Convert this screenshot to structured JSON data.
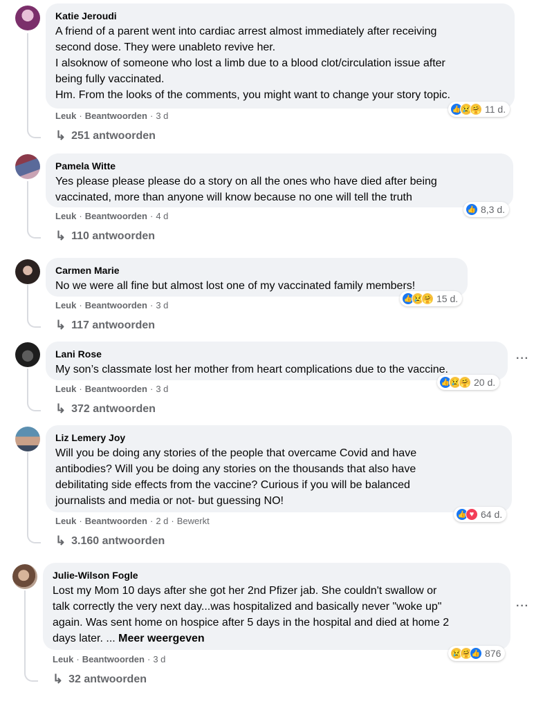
{
  "comments": [
    {
      "author": "Katie Jeroudi",
      "lines": [
        "A friend of a parent went into cardiac arrest almost immediately after receiving",
        "second dose. They were unableto revive her.",
        "I alsoknow of someone who lost a limb due to a blood clot/circulation issue after",
        "being fully vaccinated.",
        "Hm. From the looks of the comments, you might want to change your story topic."
      ],
      "reactions": [
        "like",
        "sad",
        "care"
      ],
      "reaction_count": "11 d.",
      "like": "Leuk",
      "reply": "Beantwoorden",
      "time": "3 d",
      "edited": "",
      "replies": "251 antwoorden"
    },
    {
      "author": "Pamela Witte",
      "lines": [
        "Yes please please please do a story on all the ones who have died after being",
        "vaccinated, more than anyone will know because no one will tell the truth"
      ],
      "reactions": [
        "like"
      ],
      "reaction_count": "8,3 d.",
      "like": "Leuk",
      "reply": "Beantwoorden",
      "time": "4 d",
      "edited": "",
      "replies": "110 antwoorden"
    },
    {
      "author": "Carmen Marie",
      "lines": [
        "No we were all fine but almost lost one of my vaccinated family members!"
      ],
      "reactions": [
        "like",
        "sad",
        "care"
      ],
      "reaction_count": "15 d.",
      "like": "Leuk",
      "reply": "Beantwoorden",
      "time": "3 d",
      "edited": "",
      "replies": "117 antwoorden"
    },
    {
      "author": "Lani Rose",
      "lines": [
        "My son’s classmate lost her mother from heart complications due to the vaccine."
      ],
      "reactions": [
        "like",
        "sad",
        "care"
      ],
      "reaction_count": "20 d.",
      "like": "Leuk",
      "reply": "Beantwoorden",
      "time": "3 d",
      "edited": "",
      "replies": "372 antwoorden",
      "more_menu": "···"
    },
    {
      "author": "Liz Lemery Joy",
      "lines": [
        "Will you be doing any stories of the people that overcame Covid and have",
        "antibodies? Will you be doing any stories on the thousands that also have",
        "debilitating side effects from the vaccine? Curious if you will be balanced",
        "journalists and media or not- but guessing NO!"
      ],
      "reactions": [
        "like",
        "love"
      ],
      "reaction_count": "64 d.",
      "like": "Leuk",
      "reply": "Beantwoorden",
      "time": "2 d",
      "edited": "Bewerkt",
      "replies": "3.160 antwoorden"
    },
    {
      "author": "Julie-Wilson Fogle",
      "lines": [
        "Lost my Mom 10 days after she got her 2nd Pfizer jab. She couldn't swallow or",
        "talk correctly the very next day...was hospitalized and basically never \"woke up\"",
        "again. Was sent home on hospice after 5 days in the hospital and died at home 2",
        "days later. ..."
      ],
      "see_more": "Meer weergeven",
      "reactions": [
        "sad",
        "care",
        "like"
      ],
      "reaction_count": "876",
      "like": "Leuk",
      "reply": "Beantwoorden",
      "time": "3 d",
      "edited": "",
      "replies": "32 antwoorden",
      "more_menu": "···"
    }
  ],
  "icons": {
    "like": "👍",
    "sad": "😢",
    "care": "🤗",
    "love": "♥",
    "reply_arrow": "↳"
  },
  "colors": {
    "bubble": "#f0f2f5",
    "meta_text": "#65676b",
    "like_blue": "#1877f2",
    "love_red": "#f33e58",
    "emoji_yellow": "#f7c64a"
  }
}
